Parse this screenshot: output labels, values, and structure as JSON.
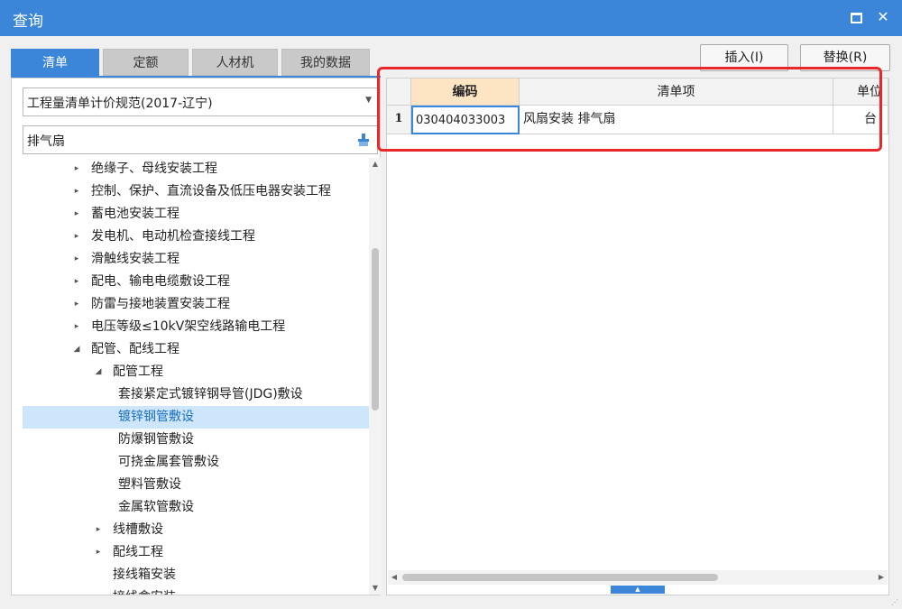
{
  "window": {
    "title": "查询"
  },
  "tabs": [
    {
      "label": "清单",
      "active": true
    },
    {
      "label": "定额",
      "active": false
    },
    {
      "label": "人材机",
      "active": false
    },
    {
      "label": "我的数据",
      "active": false
    }
  ],
  "actions": {
    "insert_label": "插入(I)",
    "replace_label": "替换(R)"
  },
  "filter": {
    "spec_selected": "工程量清单计价规范(2017-辽宁)",
    "search_value": "排气扇"
  },
  "tree": [
    {
      "label": "绝缘子、母线安装工程",
      "level": 0,
      "arrow": "▸"
    },
    {
      "label": "控制、保护、直流设备及低压电器安装工程",
      "level": 0,
      "arrow": "▸"
    },
    {
      "label": "蓄电池安装工程",
      "level": 0,
      "arrow": "▸"
    },
    {
      "label": "发电机、电动机检查接线工程",
      "level": 0,
      "arrow": "▸"
    },
    {
      "label": "滑触线安装工程",
      "level": 0,
      "arrow": "▸"
    },
    {
      "label": "配电、输电电缆敷设工程",
      "level": 0,
      "arrow": "▸"
    },
    {
      "label": "防雷与接地装置安装工程",
      "level": 0,
      "arrow": "▸"
    },
    {
      "label": "电压等级≤10kV架空线路输电工程",
      "level": 0,
      "arrow": "▸"
    },
    {
      "label": "配管、配线工程",
      "level": 0,
      "arrow": "◢"
    },
    {
      "label": "配管工程",
      "level": 1,
      "arrow": "◢"
    },
    {
      "label": "套接紧定式镀锌钢导管(JDG)敷设",
      "level": 2,
      "arrow": ""
    },
    {
      "label": "镀锌钢管敷设",
      "level": 2,
      "arrow": "",
      "selected": true
    },
    {
      "label": "防爆钢管敷设",
      "level": 2,
      "arrow": ""
    },
    {
      "label": "可挠金属套管敷设",
      "level": 2,
      "arrow": ""
    },
    {
      "label": "塑料管敷设",
      "level": 2,
      "arrow": ""
    },
    {
      "label": "金属软管敷设",
      "level": 2,
      "arrow": ""
    },
    {
      "label": "线槽敷设",
      "level": 1,
      "arrow": "▸"
    },
    {
      "label": "配线工程",
      "level": 1,
      "arrow": "▸"
    },
    {
      "label": "接线箱安装",
      "level": 1,
      "arrow": ""
    },
    {
      "label": "接线盒安装",
      "level": 1,
      "arrow": ""
    }
  ],
  "grid": {
    "headers": {
      "code": "编码",
      "item": "清单项",
      "unit": "单位"
    },
    "rows": [
      {
        "num": "1",
        "code": "030404033003",
        "item": "风扇安装 排气扇",
        "unit": "台"
      }
    ]
  }
}
